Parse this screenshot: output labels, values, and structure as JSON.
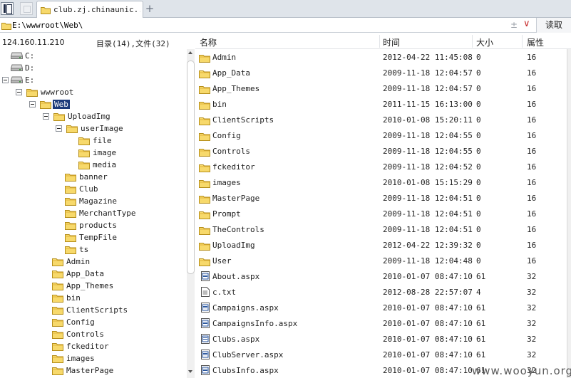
{
  "tab": {
    "title": "club.zj.chinaunic..."
  },
  "address": {
    "path": "E:\\wwwroot\\Web\\",
    "read_label": "读取",
    "add_glyph": "±",
    "dropdown_glyph": "∨"
  },
  "info": {
    "ip": "124.160.11.210",
    "counts": "目录(14),文件(32)"
  },
  "headers": {
    "name": "名称",
    "time": "时间",
    "size": "大小",
    "attr": "属性"
  },
  "colors": {
    "selection": "#1d3b7a",
    "folder_fill": "#f7d96b",
    "folder_stroke": "#b58e1a"
  },
  "tree": [
    {
      "label": "C:",
      "level": 0,
      "type": "drive"
    },
    {
      "label": "D:",
      "level": 0,
      "type": "drive"
    },
    {
      "label": "E:",
      "level": 0,
      "type": "drive",
      "expanded": true
    },
    {
      "label": "wwwroot",
      "level": 1,
      "type": "folder",
      "expanded": true
    },
    {
      "label": "Web",
      "level": 2,
      "type": "folder",
      "expanded": true,
      "selected": true
    },
    {
      "label": "UploadImg",
      "level": 3,
      "type": "folder",
      "expanded": true
    },
    {
      "label": "userImage",
      "level": 4,
      "type": "folder",
      "expanded": true
    },
    {
      "label": "file",
      "level": 5,
      "type": "folder"
    },
    {
      "label": "image",
      "level": 5,
      "type": "folder"
    },
    {
      "label": "media",
      "level": 5,
      "type": "folder"
    },
    {
      "label": "banner",
      "level": 4,
      "type": "folder"
    },
    {
      "label": "Club",
      "level": 4,
      "type": "folder"
    },
    {
      "label": "Magazine",
      "level": 4,
      "type": "folder"
    },
    {
      "label": "MerchantType",
      "level": 4,
      "type": "folder"
    },
    {
      "label": "products",
      "level": 4,
      "type": "folder"
    },
    {
      "label": "TempFile",
      "level": 4,
      "type": "folder"
    },
    {
      "label": "ts",
      "level": 4,
      "type": "folder"
    },
    {
      "label": "Admin",
      "level": 3,
      "type": "folder"
    },
    {
      "label": "App_Data",
      "level": 3,
      "type": "folder"
    },
    {
      "label": "App_Themes",
      "level": 3,
      "type": "folder"
    },
    {
      "label": "bin",
      "level": 3,
      "type": "folder"
    },
    {
      "label": "ClientScripts",
      "level": 3,
      "type": "folder"
    },
    {
      "label": "Config",
      "level": 3,
      "type": "folder"
    },
    {
      "label": "Controls",
      "level": 3,
      "type": "folder"
    },
    {
      "label": "fckeditor",
      "level": 3,
      "type": "folder"
    },
    {
      "label": "images",
      "level": 3,
      "type": "folder"
    },
    {
      "label": "MasterPage",
      "level": 3,
      "type": "folder"
    }
  ],
  "files": [
    {
      "name": "Admin",
      "type": "folder",
      "time": "2012-04-22 11:45:08",
      "size": "0",
      "attr": "16"
    },
    {
      "name": "App_Data",
      "type": "folder",
      "time": "2009-11-18 12:04:57",
      "size": "0",
      "attr": "16"
    },
    {
      "name": "App_Themes",
      "type": "folder",
      "time": "2009-11-18 12:04:57",
      "size": "0",
      "attr": "16"
    },
    {
      "name": "bin",
      "type": "folder",
      "time": "2011-11-15 16:13:00",
      "size": "0",
      "attr": "16"
    },
    {
      "name": "ClientScripts",
      "type": "folder",
      "time": "2010-01-08 15:20:11",
      "size": "0",
      "attr": "16"
    },
    {
      "name": "Config",
      "type": "folder",
      "time": "2009-11-18 12:04:55",
      "size": "0",
      "attr": "16"
    },
    {
      "name": "Controls",
      "type": "folder",
      "time": "2009-11-18 12:04:55",
      "size": "0",
      "attr": "16"
    },
    {
      "name": "fckeditor",
      "type": "folder",
      "time": "2009-11-18 12:04:52",
      "size": "0",
      "attr": "16"
    },
    {
      "name": "images",
      "type": "folder",
      "time": "2010-01-08 15:15:29",
      "size": "0",
      "attr": "16"
    },
    {
      "name": "MasterPage",
      "type": "folder",
      "time": "2009-11-18 12:04:51",
      "size": "0",
      "attr": "16"
    },
    {
      "name": "Prompt",
      "type": "folder",
      "time": "2009-11-18 12:04:51",
      "size": "0",
      "attr": "16"
    },
    {
      "name": "TheControls",
      "type": "folder",
      "time": "2009-11-18 12:04:51",
      "size": "0",
      "attr": "16"
    },
    {
      "name": "UploadImg",
      "type": "folder",
      "time": "2012-04-22 12:39:32",
      "size": "0",
      "attr": "16"
    },
    {
      "name": "User",
      "type": "folder",
      "time": "2009-11-18 12:04:48",
      "size": "0",
      "attr": "16"
    },
    {
      "name": "About.aspx",
      "type": "aspx",
      "time": "2010-01-07 08:47:10",
      "size": "61",
      "attr": "32"
    },
    {
      "name": "c.txt",
      "type": "txt",
      "time": "2012-08-28 22:57:07",
      "size": "4",
      "attr": "32"
    },
    {
      "name": "Campaigns.aspx",
      "type": "aspx",
      "time": "2010-01-07 08:47:10",
      "size": "61",
      "attr": "32"
    },
    {
      "name": "CampaignsInfo.aspx",
      "type": "aspx",
      "time": "2010-01-07 08:47:10",
      "size": "61",
      "attr": "32"
    },
    {
      "name": "Clubs.aspx",
      "type": "aspx",
      "time": "2010-01-07 08:47:10",
      "size": "61",
      "attr": "32"
    },
    {
      "name": "ClubServer.aspx",
      "type": "aspx",
      "time": "2010-01-07 08:47:10",
      "size": "61",
      "attr": "32"
    },
    {
      "name": "ClubsInfo.aspx",
      "type": "aspx",
      "time": "2010-01-07 08:47:10",
      "size": "61",
      "attr": "32"
    }
  ],
  "watermark": "www.wooyun.org"
}
